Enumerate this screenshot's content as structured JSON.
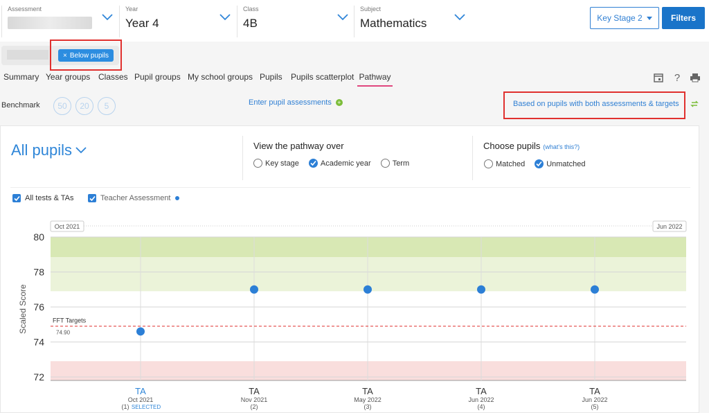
{
  "header": {
    "assessment": {
      "label": "Assessment"
    },
    "year": {
      "label": "Year",
      "value": "Year 4"
    },
    "class": {
      "label": "Class",
      "value": "4B"
    },
    "subject": {
      "label": "Subject",
      "value": "Mathematics"
    },
    "key_stage_label": "Key Stage 2",
    "filters_label": "Filters"
  },
  "filter_chip": {
    "label": "Below pupils",
    "remove_glyph": "×"
  },
  "tabs": [
    {
      "label": "Summary"
    },
    {
      "label": "Year groups"
    },
    {
      "label": "Classes"
    },
    {
      "label": "Pupil groups"
    },
    {
      "label": "My school groups"
    },
    {
      "label": "Pupils"
    },
    {
      "label": "Pupils scatterplot"
    },
    {
      "label": "Pathway",
      "active": true
    }
  ],
  "benchmark": {
    "label": "Benchmark",
    "values": [
      "50",
      "20",
      "5"
    ]
  },
  "enter_link": "Enter pupil assessments",
  "based_on_link": "Based on pupils with both assessments & targets",
  "panel": {
    "group": "All pupils",
    "pathway_title": "View the pathway over",
    "pathway_options": [
      {
        "label": "Key stage",
        "selected": false
      },
      {
        "label": "Academic year",
        "selected": true
      },
      {
        "label": "Term",
        "selected": false
      }
    ],
    "choose_title": "Choose pupils",
    "whats_this": "(what's this?)",
    "choose_options": [
      {
        "label": "Matched",
        "selected": false
      },
      {
        "label": "Unmatched",
        "selected": true
      }
    ],
    "checkbox_all": "All tests & TAs",
    "checkbox_ta": "Teacher Assessment"
  },
  "colors": {
    "accent": "#2f86d8",
    "point": "#2c7fd6",
    "target_line": "#e0302e",
    "band_green": "#d8e8b4",
    "band_light_green": "#ebf3d9",
    "band_red": "#f9dedd"
  },
  "chart_data": {
    "type": "scatter",
    "ylabel": "Scaled Score",
    "ylim": [
      71.8,
      80
    ],
    "yticks": [
      72,
      74,
      76,
      78,
      80
    ],
    "range_start_label": "Oct 2021",
    "range_end_label": "Jun 2022",
    "target": {
      "label": "FFT Targets",
      "value": 74.9,
      "value_label": "74.90"
    },
    "bands": [
      {
        "from": 78.85,
        "to": 80,
        "color": "#d8e8b4"
      },
      {
        "from": 76.9,
        "to": 78.85,
        "color": "#ebf3d9"
      },
      {
        "from": 71.8,
        "to": 72.9,
        "color": "#f9dedd"
      }
    ],
    "points": [
      {
        "type": "TA",
        "date": "Oct 2021",
        "index": "(1)",
        "value": 74.6,
        "selected": true,
        "selected_label": "SELECTED"
      },
      {
        "type": "TA",
        "date": "Nov 2021",
        "index": "(2)",
        "value": 77.0,
        "selected": false
      },
      {
        "type": "TA",
        "date": "May 2022",
        "index": "(3)",
        "value": 77.0,
        "selected": false
      },
      {
        "type": "TA",
        "date": "Jun 2022",
        "index": "(4)",
        "value": 77.0,
        "selected": false
      },
      {
        "type": "TA",
        "date": "Jun 2022",
        "index": "(5)",
        "value": 77.0,
        "selected": false
      }
    ]
  }
}
